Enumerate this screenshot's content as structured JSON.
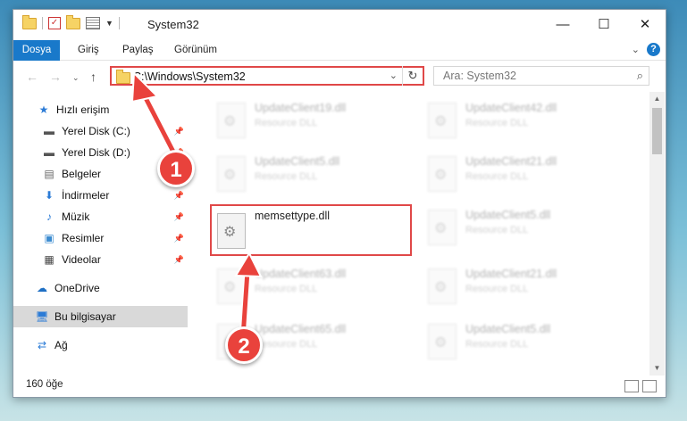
{
  "window": {
    "title": "System32",
    "controls": {
      "minimize": "—",
      "maximize": "☐",
      "close": "✕"
    }
  },
  "ribbon": {
    "tabs": [
      "Dosya",
      "Giriş",
      "Paylaş",
      "Görünüm"
    ]
  },
  "address_bar": {
    "path": "C:\\Windows\\System32",
    "search_placeholder": "Ara: System32"
  },
  "sidebar": {
    "items": [
      {
        "label": "Hızlı erişim",
        "icon": "star-icon",
        "pinned": false
      },
      {
        "label": "Yerel Disk (C:)",
        "icon": "drive-icon",
        "pinned": true
      },
      {
        "label": "Yerel Disk (D:)",
        "icon": "drive-icon",
        "pinned": true
      },
      {
        "label": "Belgeler",
        "icon": "documents-icon",
        "pinned": true
      },
      {
        "label": "İndirmeler",
        "icon": "download-icon",
        "pinned": true
      },
      {
        "label": "Müzik",
        "icon": "music-icon",
        "pinned": true
      },
      {
        "label": "Resimler",
        "icon": "pictures-icon",
        "pinned": true
      },
      {
        "label": "Videolar",
        "icon": "video-icon",
        "pinned": true
      },
      {
        "label": "OneDrive",
        "icon": "cloud-icon",
        "pinned": false
      },
      {
        "label": "Bu bilgisayar",
        "icon": "computer-icon",
        "pinned": false
      },
      {
        "label": "Ağ",
        "icon": "network-icon",
        "pinned": false
      }
    ]
  },
  "files": [
    {
      "name": "UpdateClient19.dll",
      "type": "Resource DLL",
      "faded": true
    },
    {
      "name": "UpdateClient42.dll",
      "type": "Resource DLL",
      "faded": true
    },
    {
      "name": "UpdateClient5.dll",
      "type": "Resource DLL",
      "faded": true
    },
    {
      "name": "UpdateClient21.dll",
      "type": "Resource DLL",
      "faded": true
    },
    {
      "name": "memsettype.dll",
      "type": "",
      "faded": false
    },
    {
      "name": "UpdateClient5.dll",
      "type": "Resource DLL",
      "faded": true
    },
    {
      "name": "UpdateClient63.dll",
      "type": "Resource DLL",
      "faded": true
    },
    {
      "name": "UpdateClient21.dll",
      "type": "Resource DLL",
      "faded": true
    },
    {
      "name": "UpdateClient65.dll",
      "type": "Resource DLL",
      "faded": true
    },
    {
      "name": "UpdateClient5.dll",
      "type": "Resource DLL",
      "faded": true
    }
  ],
  "status": {
    "item_count": "160 öğe"
  },
  "annotations": {
    "step1": "1",
    "step2": "2",
    "color": "#e9423c"
  }
}
